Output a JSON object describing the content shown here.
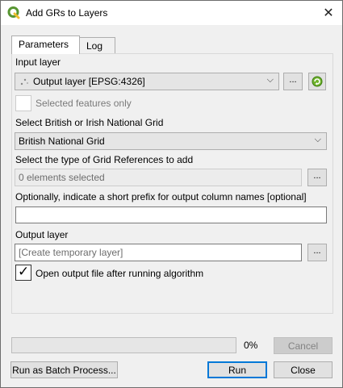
{
  "window": {
    "title": "Add GRs to Layers",
    "close_glyph": "✕"
  },
  "tabs": [
    {
      "label": "Parameters",
      "active": true
    },
    {
      "label": "Log",
      "active": false
    }
  ],
  "form": {
    "input_layer_label": "Input layer",
    "input_layer_value": "Output layer [EPSG:4326]",
    "input_layer_dots": "...",
    "selected_only_label": "Selected features only",
    "grid_label": "Select British or Irish National Grid",
    "grid_value": "British National Grid",
    "grid_type_label": "Select the type of Grid References to add",
    "grid_type_value": "0 elements selected",
    "grid_type_dots": "...",
    "prefix_label": "Optionally, indicate a short prefix for output column names [optional]",
    "prefix_value": "",
    "output_label": "Output layer",
    "output_placeholder": "[Create temporary layer]",
    "output_dots": "...",
    "open_output_label": "Open output file after running algorithm"
  },
  "footer": {
    "progress_percent": 0,
    "progress_text": "0%",
    "cancel_label": "Cancel",
    "batch_label": "Run as Batch Process...",
    "run_label": "Run",
    "close_label": "Close"
  },
  "icons": {
    "app": "qgis-logo-icon",
    "layer": "point-layer-icon",
    "iterate": "iterate-green-arrow-icon",
    "dropdown": "chevron-down-icon"
  },
  "colors": {
    "accent": "#0078d7",
    "qgis_green": "#589632",
    "qgis_yellow": "#eebd2c"
  }
}
